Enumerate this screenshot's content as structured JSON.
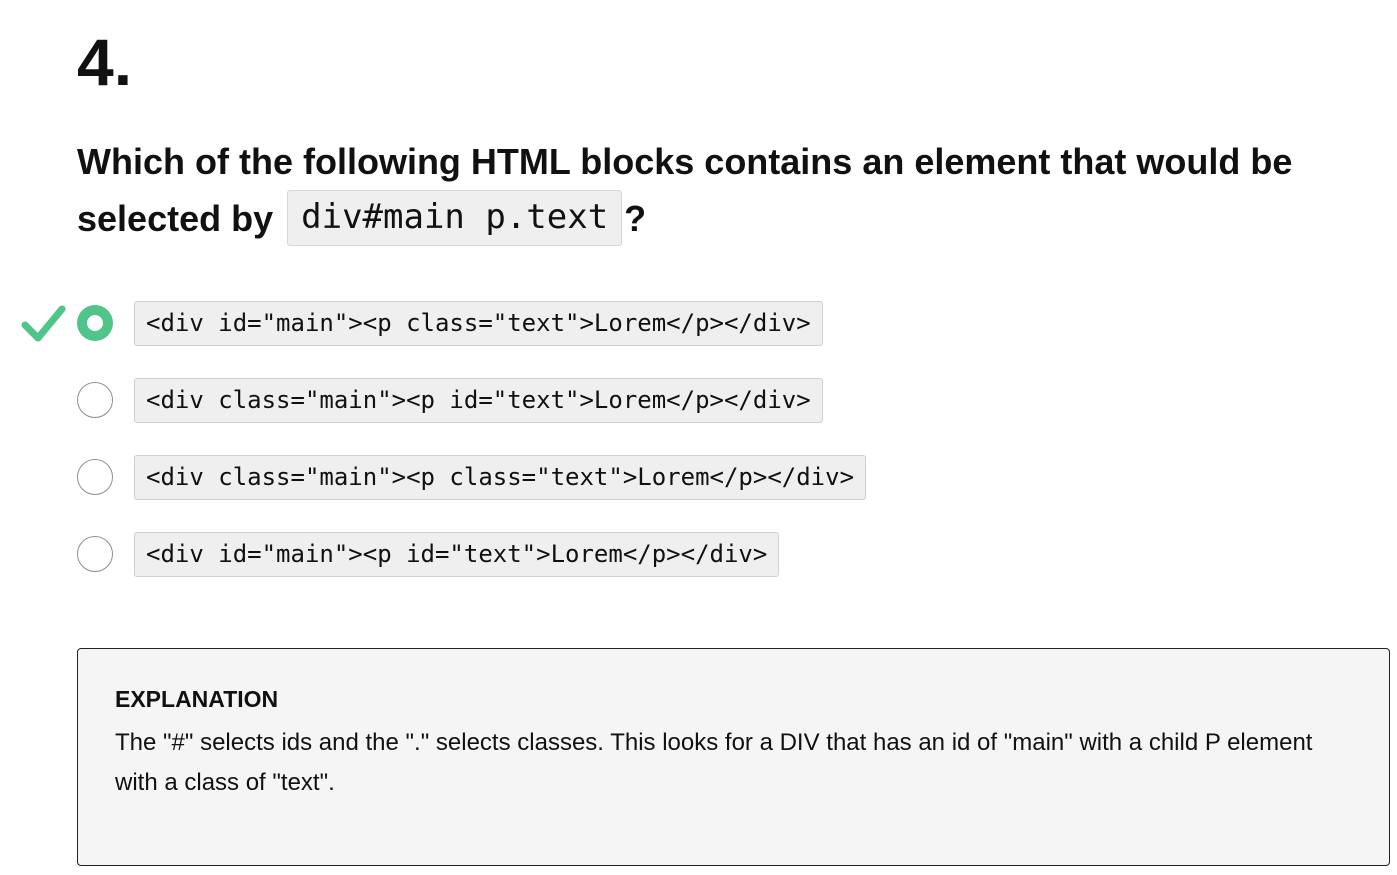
{
  "question": {
    "number": "4.",
    "text_before": "Which of the following HTML blocks contains an element that would be selected by",
    "code": "div#main p.text",
    "text_after": "?"
  },
  "options": [
    {
      "code": "<div id=\"main\"><p class=\"text\">Lorem</p></div>",
      "selected": true,
      "correct": true
    },
    {
      "code": "<div class=\"main\"><p id=\"text\">Lorem</p></div>",
      "selected": false,
      "correct": false
    },
    {
      "code": "<div class=\"main\"><p class=\"text\">Lorem</p></div>",
      "selected": false,
      "correct": false
    },
    {
      "code": "<div id=\"main\"><p id=\"text\">Lorem</p></div>",
      "selected": false,
      "correct": false
    }
  ],
  "icons": {
    "correct": "check-icon"
  },
  "colors": {
    "accent_green": "#4fc58a",
    "code_background": "#efefef",
    "explanation_background": "#f5f5f5"
  },
  "explanation": {
    "heading": "EXPLANATION",
    "body": "The \"#\" selects ids and the \".\" selects classes. This looks for a DIV that has an id of \"main\" with a child P element with a class of \"text\"."
  }
}
